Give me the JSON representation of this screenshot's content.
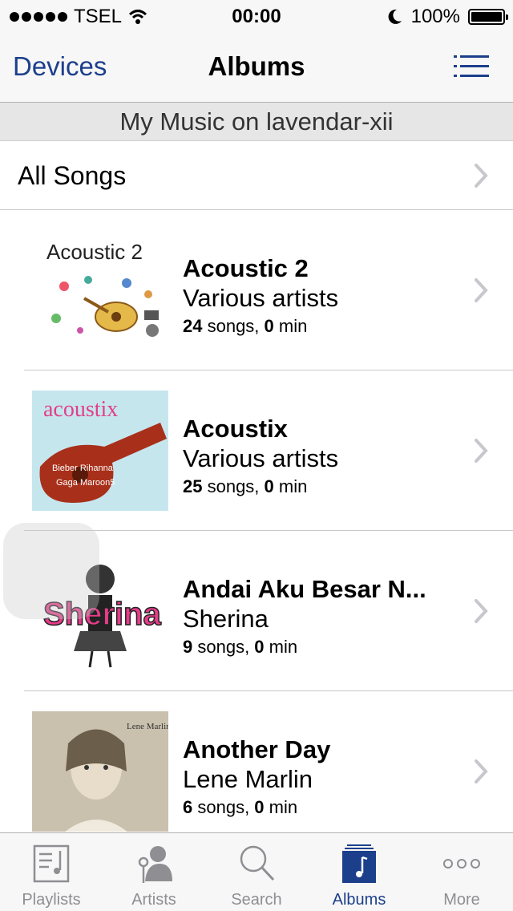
{
  "status_bar": {
    "carrier": "TSEL",
    "time": "00:00",
    "battery": "100%"
  },
  "nav": {
    "back_label": "Devices",
    "title": "Albums",
    "list_icon": "list-icon"
  },
  "section_header": "My Music on lavendar-xii",
  "all_songs": {
    "label": "All Songs"
  },
  "albums": [
    {
      "title": "Acoustic 2",
      "artist": "Various artists",
      "songs": "24",
      "songs_suffix": " songs, ",
      "minutes": "0",
      "minutes_suffix": " min",
      "cover_text": "Acoustic 2"
    },
    {
      "title": "Acoustix",
      "artist": "Various artists",
      "songs": "25",
      "songs_suffix": " songs, ",
      "minutes": "0",
      "minutes_suffix": " min",
      "cover_text": "acoustix"
    },
    {
      "title": "Andai Aku Besar N...",
      "artist": "Sherina",
      "songs": "9",
      "songs_suffix": " songs, ",
      "minutes": "0",
      "minutes_suffix": " min",
      "cover_text": "Sherina"
    },
    {
      "title": "Another Day",
      "artist": "Lene Marlin",
      "songs": "6",
      "songs_suffix": " songs, ",
      "minutes": "0",
      "minutes_suffix": " min",
      "cover_text": "Lene Marlin"
    }
  ],
  "tabs": [
    {
      "label": "Playlists",
      "icon": "playlists-icon"
    },
    {
      "label": "Artists",
      "icon": "artists-icon"
    },
    {
      "label": "Search",
      "icon": "search-icon"
    },
    {
      "label": "Albums",
      "icon": "albums-icon",
      "active": true
    },
    {
      "label": "More",
      "icon": "more-icon"
    }
  ],
  "colors": {
    "accent": "#1c3f8c",
    "inactive": "#8e8e93"
  }
}
